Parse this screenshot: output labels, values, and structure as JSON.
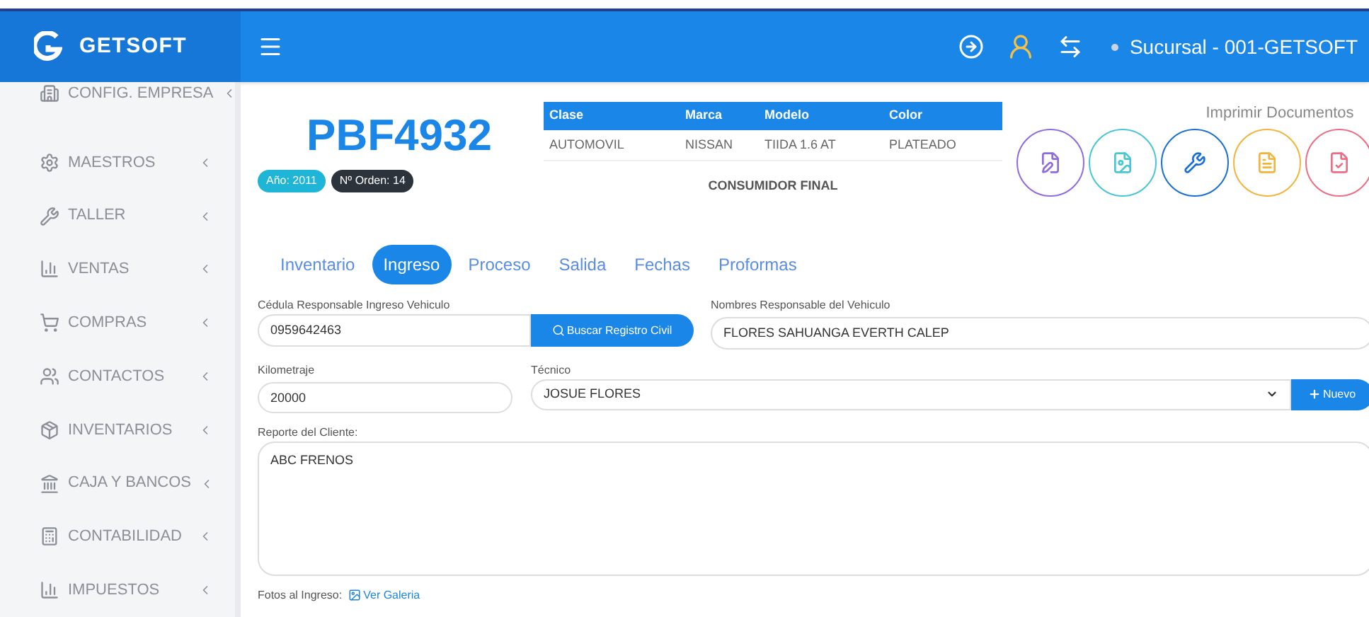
{
  "header": {
    "brand": "GETSOFT",
    "branch": "Sucursal - 001-GETSOFT"
  },
  "sidebar": {
    "items": [
      {
        "label": "CONFIG. EMPRESA"
      },
      {
        "label": "MAESTROS"
      },
      {
        "label": "TALLER"
      },
      {
        "label": "VENTAS"
      },
      {
        "label": "COMPRAS"
      },
      {
        "label": "CONTACTOS"
      },
      {
        "label": "INVENTARIOS"
      },
      {
        "label": "CAJA Y BANCOS"
      },
      {
        "label": "CONTABILIDAD"
      },
      {
        "label": "IMPUESTOS"
      }
    ]
  },
  "vehicle": {
    "plate": "PBF4932",
    "badges": [
      {
        "text": "Año: 2011",
        "color": "#1fb5d6"
      },
      {
        "text": "Nº Orden: 14",
        "color": "#2d333b"
      }
    ],
    "table": {
      "columns": [
        "Clase",
        "Marca",
        "Modelo",
        "Color"
      ],
      "row": [
        "AUTOMOVIL",
        "NISSAN",
        "TIIDA 1.6 AT",
        "PLATEADO"
      ],
      "footer": "CONSUMIDOR FINAL"
    }
  },
  "print": {
    "title": "Imprimir Documentos",
    "buttons": [
      {
        "color": "#8e6be0"
      },
      {
        "color": "#48c6d6"
      },
      {
        "color": "#1a6fd4"
      },
      {
        "color": "#f1b43c"
      },
      {
        "color": "#ec6d86"
      }
    ]
  },
  "tabs": [
    {
      "label": "Inventario",
      "selected": false
    },
    {
      "label": "Ingreso",
      "selected": true
    },
    {
      "label": "Proceso",
      "selected": false
    },
    {
      "label": "Salida",
      "selected": false
    },
    {
      "label": "Fechas",
      "selected": false
    },
    {
      "label": "Proformas",
      "selected": false
    }
  ],
  "form": {
    "cedula": {
      "label": "Cédula Responsable Ingreso Vehiculo",
      "value": "0959642463",
      "button": "Buscar Registro Civil"
    },
    "nombres": {
      "label": "Nombres Responsable del Vehiculo",
      "value": "FLORES SAHUANGA EVERTH CALEP"
    },
    "kilometraje": {
      "label": "Kilometraje",
      "value": "20000"
    },
    "tecnico": {
      "label": "Técnico",
      "value": "JOSUE FLORES",
      "button": "Nuevo"
    },
    "reporte": {
      "label": "Reporte del Cliente:",
      "value": "ABC FRENOS"
    },
    "fotos": {
      "label": "Fotos al Ingreso:",
      "link": "Ver Galeria"
    }
  }
}
